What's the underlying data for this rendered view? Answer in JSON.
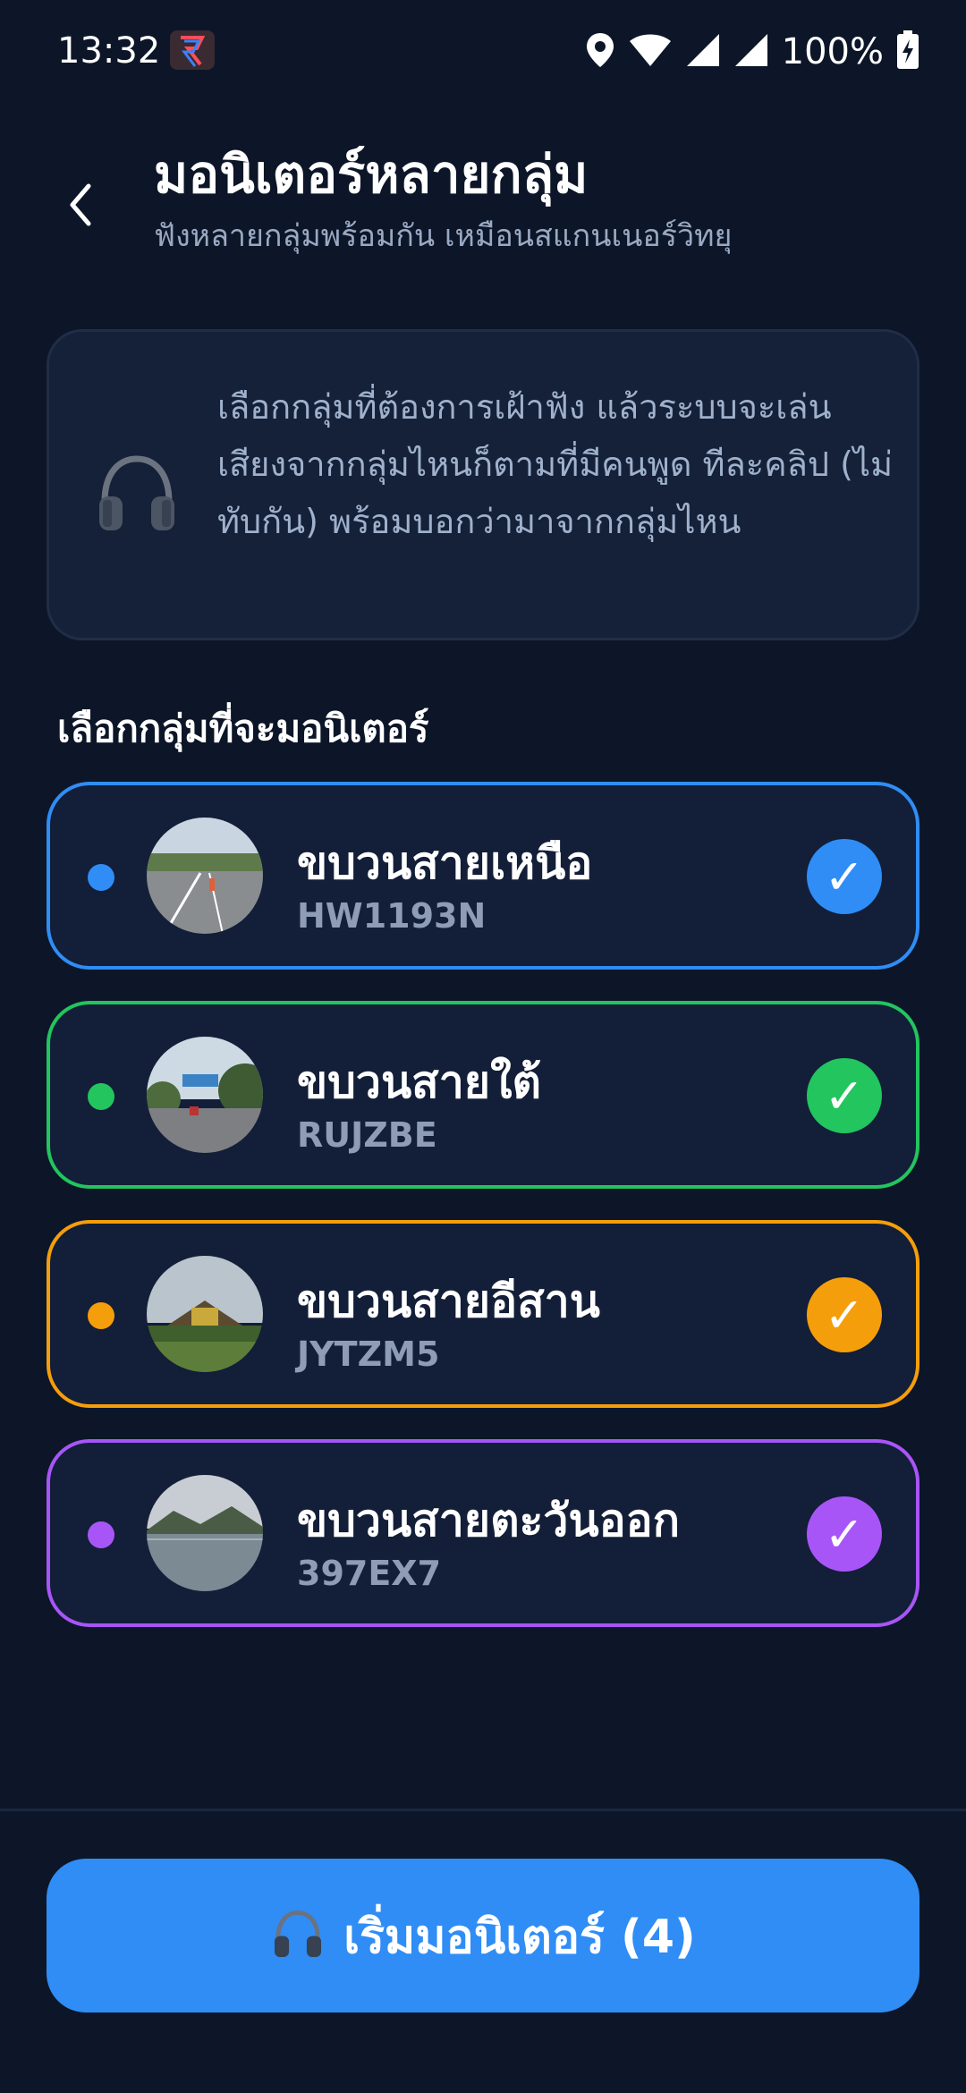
{
  "status_bar": {
    "time": "13:32",
    "battery": "100%",
    "icons": [
      "app-icon",
      "location-icon",
      "wifi-icon",
      "signal-icon",
      "signal-icon",
      "battery-charging-icon"
    ]
  },
  "header": {
    "back_icon": "chevron-left-icon",
    "title": "มอนิเตอร์หลายกลุ่ม",
    "subtitle": "ฟังหลายกลุ่มพร้อมกัน เหมือนสแกนเนอร์วิทยุ"
  },
  "info": {
    "icon": "headphones-icon",
    "text": "เลือกกลุ่มที่ต้องการเฝ้าฟัง แล้วระบบจะเล่นเสียงจากกลุ่มไหนก็ตามที่มีคนพูด ทีละคลิป (ไม่ทับกัน) พร้อมบอกว่ามาจากกลุ่มไหน"
  },
  "section_label": "เลือกกลุ่มที่จะมอนิเตอร์",
  "groups": [
    {
      "name": "ขบวนสายเหนือ",
      "code": "HW1193N",
      "color": "#2f8df5",
      "selected": true,
      "check": "✓"
    },
    {
      "name": "ขบวนสายใต้",
      "code": "RUJZBE",
      "color": "#22c55e",
      "selected": true,
      "check": "✓"
    },
    {
      "name": "ขบวนสายอีสาน",
      "code": "JYTZM5",
      "color": "#f59e0b",
      "selected": true,
      "check": "✓"
    },
    {
      "name": "ขบวนสายตะวันออก",
      "code": "397EX7",
      "color": "#a855f7",
      "selected": true,
      "check": "✓"
    }
  ],
  "start_button": {
    "icon": "headphones-icon",
    "label": "เริ่มมอนิเตอร์ (4)"
  }
}
